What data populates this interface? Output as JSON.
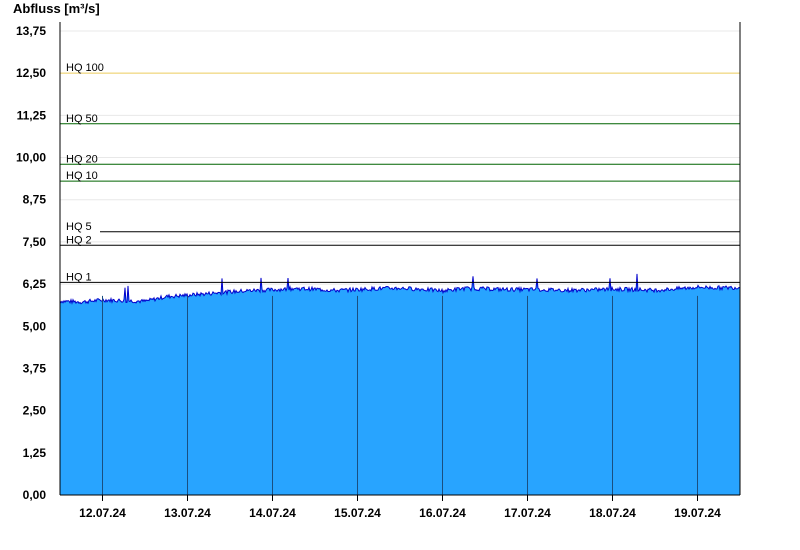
{
  "chart_data": {
    "type": "area",
    "ylabel": "Abfluss [m³/s]",
    "ylim": [
      0,
      13.75
    ],
    "yticks": [
      "0,00",
      "1,25",
      "2,50",
      "3,75",
      "5,00",
      "6,25",
      "7,50",
      "8,75",
      "10,00",
      "11,25",
      "12,50",
      "13,75"
    ],
    "xlim": [
      "2024-07-11T12:00",
      "2024-07-19T12:00"
    ],
    "xticks": [
      "12.07.24",
      "13.07.24",
      "14.07.24",
      "15.07.24",
      "16.07.24",
      "17.07.24",
      "18.07.24",
      "19.07.24"
    ],
    "grid": "horizontal",
    "thresholds": [
      {
        "label": "HQ 100",
        "value": 12.5,
        "color": "#f0d060"
      },
      {
        "label": "HQ 50",
        "value": 11.0,
        "color": "#006400"
      },
      {
        "label": "HQ 20",
        "value": 9.8,
        "color": "#006400"
      },
      {
        "label": "HQ 10",
        "value": 9.3,
        "color": "#006400"
      },
      {
        "label": "HQ 5",
        "value": 7.8,
        "color": "#000000"
      },
      {
        "label": "HQ 2",
        "value": 7.4,
        "color": "#000000"
      },
      {
        "label": "HQ 1",
        "value": 6.3,
        "color": "#000000"
      }
    ],
    "series": [
      {
        "color": "#28a4ff",
        "line_color": "#0000cc",
        "x": [
          "2024-07-11T12:00",
          "2024-07-11T18:00",
          "2024-07-12T00:00",
          "2024-07-12T06:00",
          "2024-07-12T12:00",
          "2024-07-12T18:00",
          "2024-07-13T00:00",
          "2024-07-13T06:00",
          "2024-07-13T12:00",
          "2024-07-13T18:00",
          "2024-07-14T00:00",
          "2024-07-14T06:00",
          "2024-07-14T12:00",
          "2024-07-14T18:00",
          "2024-07-15T00:00",
          "2024-07-15T06:00",
          "2024-07-15T12:00",
          "2024-07-15T18:00",
          "2024-07-16T00:00",
          "2024-07-16T06:00",
          "2024-07-16T12:00",
          "2024-07-16T18:00",
          "2024-07-17T00:00",
          "2024-07-17T06:00",
          "2024-07-17T12:00",
          "2024-07-17T18:00",
          "2024-07-18T00:00",
          "2024-07-18T06:00",
          "2024-07-18T12:00",
          "2024-07-18T18:00",
          "2024-07-19T00:00",
          "2024-07-19T06:00",
          "2024-07-19T12:00"
        ],
        "values": [
          5.75,
          5.72,
          5.78,
          5.76,
          5.74,
          5.88,
          5.92,
          5.97,
          6.02,
          6.06,
          6.08,
          6.12,
          6.1,
          6.06,
          6.09,
          6.12,
          6.13,
          6.1,
          6.05,
          6.12,
          6.11,
          6.09,
          6.09,
          6.08,
          6.07,
          6.08,
          6.1,
          6.09,
          6.07,
          6.11,
          6.16,
          6.14,
          6.15
        ]
      }
    ]
  }
}
